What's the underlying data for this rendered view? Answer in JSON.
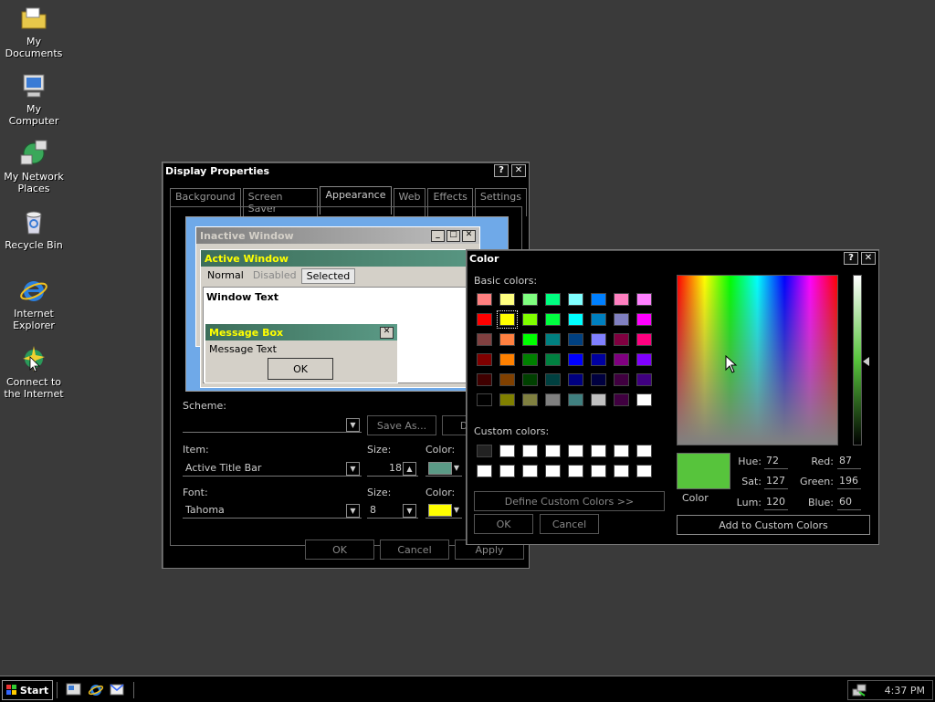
{
  "desktop": {
    "icons": [
      {
        "label": "My Documents"
      },
      {
        "label": "My Computer"
      },
      {
        "label": "My Network Places"
      },
      {
        "label": "Recycle Bin"
      },
      {
        "label": "Internet Explorer"
      },
      {
        "label": "Connect to the Internet"
      }
    ]
  },
  "display": {
    "title": "Display Properties",
    "help": "?",
    "close": "✕",
    "tabs": [
      "Background",
      "Screen Saver",
      "Appearance",
      "Web",
      "Effects",
      "Settings"
    ],
    "preview": {
      "inactive_title": "Inactive Window",
      "active_title": "Active Window",
      "menu": [
        "Normal",
        "Disabled",
        "Selected"
      ],
      "window_text": "Window Text",
      "msg_title": "Message Box",
      "msg_text": "Message Text",
      "ok": "OK"
    },
    "scheme_label": "Scheme:",
    "scheme_value": "",
    "save_as": "Save As...",
    "delete": "Delete",
    "item_label": "Item:",
    "item_value": "Active Title Bar",
    "size_label": "Size:",
    "item_size": "18",
    "color_label": "Color:",
    "item_color": "#5b9a86",
    "font_label": "Font:",
    "font_value": "Tahoma",
    "font_size_label": "Size:",
    "font_size": "8",
    "font_color_label": "Color:",
    "font_color": "#ffff00",
    "ok": "OK",
    "cancel": "Cancel",
    "apply": "Apply"
  },
  "color": {
    "title": "Color",
    "help": "?",
    "close": "✕",
    "basic_label": "Basic colors:",
    "basic": [
      "#ff8080",
      "#ffff80",
      "#80ff80",
      "#00ff80",
      "#80ffff",
      "#0080ff",
      "#ff80c0",
      "#ff80ff",
      "#ff0000",
      "#ffff00",
      "#80ff00",
      "#00ff40",
      "#00ffff",
      "#0080c0",
      "#8080c0",
      "#ff00ff",
      "#804040",
      "#ff8040",
      "#00ff00",
      "#008080",
      "#004080",
      "#8080ff",
      "#800040",
      "#ff0080",
      "#800000",
      "#ff8000",
      "#008000",
      "#008040",
      "#0000ff",
      "#0000a0",
      "#800080",
      "#8000ff",
      "#400000",
      "#804000",
      "#004000",
      "#004040",
      "#000080",
      "#000040",
      "#400040",
      "#400080",
      "#000000",
      "#808000",
      "#808040",
      "#808080",
      "#408080",
      "#c0c0c0",
      "#400040",
      "#ffffff"
    ],
    "custom_label": "Custom colors:",
    "custom": [
      "#222222",
      "#ffffff",
      "#ffffff",
      "#ffffff",
      "#ffffff",
      "#ffffff",
      "#ffffff",
      "#ffffff",
      "#ffffff",
      "#ffffff",
      "#ffffff",
      "#ffffff",
      "#ffffff",
      "#ffffff",
      "#ffffff",
      "#ffffff"
    ],
    "define": "Define Custom Colors >>",
    "ok": "OK",
    "cancel": "Cancel",
    "preview_color": "#57c43c",
    "preview_label": "Color",
    "hue_label": "Hue:",
    "hue": "72",
    "sat_label": "Sat:",
    "sat": "127",
    "lum_label": "Lum:",
    "lum": "120",
    "red_label": "Red:",
    "red": "87",
    "green_label": "Green:",
    "green": "196",
    "blue_label": "Blue:",
    "blue": "60",
    "add": "Add to Custom Colors"
  },
  "taskbar": {
    "start": "Start",
    "clock": "4:37 PM"
  }
}
